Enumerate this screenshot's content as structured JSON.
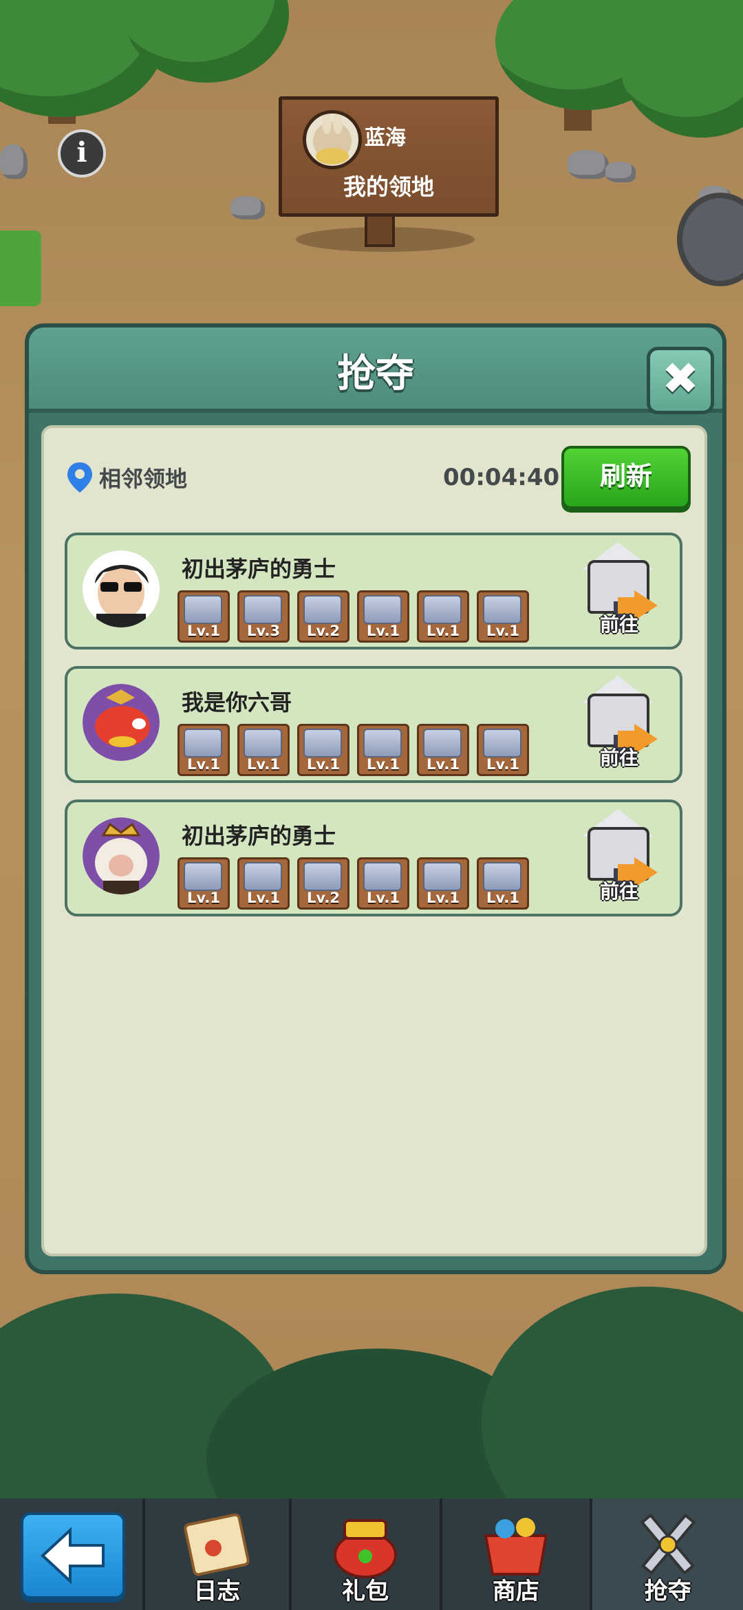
{
  "sign": {
    "player_name": "蓝海",
    "title": "我的领地"
  },
  "info_icon_glyph": "i",
  "modal": {
    "title": "抢夺",
    "close_glyph": "✖",
    "region_label": "相邻领地",
    "timer": "00:04:40",
    "refresh_label": "刷新",
    "players": [
      {
        "name": "初出茅庐的勇士",
        "avatar_icon": "sunglasses-man-avatar",
        "defenses": [
          "Lv.1",
          "Lv.3",
          "Lv.2",
          "Lv.1",
          "Lv.1",
          "Lv.1"
        ],
        "go_label": "前往"
      },
      {
        "name": "我是你六哥",
        "avatar_icon": "red-fish-avatar",
        "defenses": [
          "Lv.1",
          "Lv.1",
          "Lv.1",
          "Lv.1",
          "Lv.1",
          "Lv.1"
        ],
        "go_label": "前往"
      },
      {
        "name": "初出茅庐的勇士",
        "avatar_icon": "crowned-sheep-avatar",
        "defenses": [
          "Lv.1",
          "Lv.1",
          "Lv.2",
          "Lv.1",
          "Lv.1",
          "Lv.1"
        ],
        "go_label": "前往"
      }
    ]
  },
  "nav": {
    "back_icon": "left-arrow-icon",
    "items": [
      {
        "label": "日志",
        "icon": "scroll-icon"
      },
      {
        "label": "礼包",
        "icon": "treasure-pot-icon"
      },
      {
        "label": "商店",
        "icon": "shop-basket-icon"
      },
      {
        "label": "抢夺",
        "icon": "crossed-swords-icon"
      }
    ]
  },
  "colors": {
    "accent_green": "#3ec22a",
    "modal_teal": "#4e8b7c",
    "card_green": "#d4e6c0",
    "go_arrow": "#f29a2b"
  }
}
